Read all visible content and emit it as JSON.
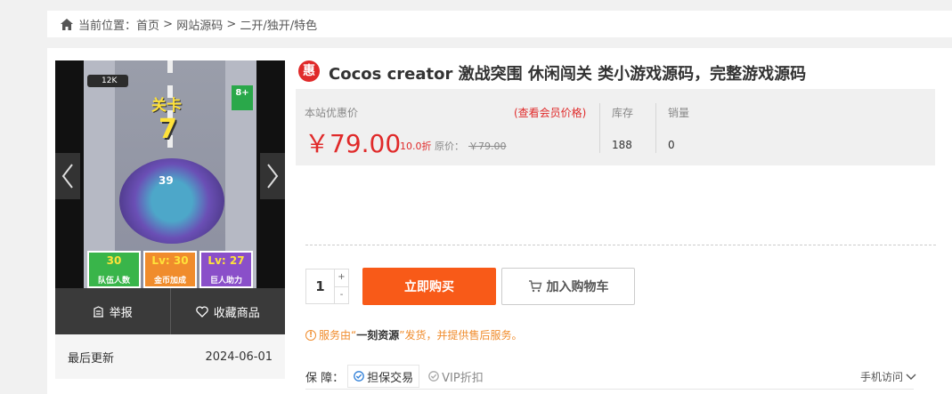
{
  "breadcrumb": {
    "label": "当前位置：",
    "items": [
      "首页",
      "网站源码",
      "二开/独开/特色"
    ],
    "separator": " > "
  },
  "gallery": {
    "game": {
      "level_label": "关卡",
      "level_number": "7",
      "crowd_count": "39",
      "top_count": "12K",
      "age_rating": "8+",
      "tiles": [
        {
          "value": "30",
          "label": "队伍人数"
        },
        {
          "value": "Lv: 30",
          "label": "金币加成"
        },
        {
          "value": "Lv: 27",
          "label": "巨人助力"
        }
      ]
    }
  },
  "actions": {
    "report": "举报",
    "favorite": "收藏商品"
  },
  "meta": {
    "last_update_label": "最后更新",
    "last_update_value": "2024-06-01"
  },
  "product": {
    "badge": "惠",
    "title": "Cocos creator 激战突围 休闲闯关 类小游戏源码，完整游戏源码",
    "price_label": "本站优惠价",
    "vip_link": "(查看会员价格)",
    "price": "￥79.00",
    "discount": "10.0折",
    "original_label": "原价：",
    "original_price": "￥79.00",
    "stock_label": "库存",
    "stock_value": "188",
    "sales_label": "销量",
    "sales_value": "0"
  },
  "purchase": {
    "quantity": "1",
    "plus": "+",
    "minus": "-",
    "buy_label": "立即购买",
    "cart_label": "加入购物车"
  },
  "service": {
    "prefix": "服务由“",
    "provider": "一刻资源",
    "suffix": "”发货，并提供售后服务。"
  },
  "guarantee": {
    "label": "保  障：",
    "items": [
      "担保交易",
      "VIP折扣"
    ],
    "mobile_label": "手机访问"
  },
  "colors": {
    "accent_red": "#e02a2a",
    "buy_orange": "#f85a18",
    "service_orange": "#f08c2c"
  }
}
